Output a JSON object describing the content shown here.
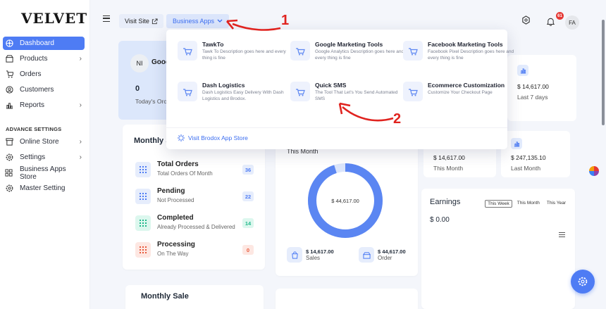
{
  "brand": {
    "logo": "VELVET"
  },
  "sidebar": {
    "items": [
      {
        "label": "Dashboard",
        "icon": "dashboard-icon",
        "active": true,
        "chevron": false
      },
      {
        "label": "Products",
        "icon": "products-icon",
        "chevron": true
      },
      {
        "label": "Orders",
        "icon": "cart-icon",
        "chevron": false
      },
      {
        "label": "Customers",
        "icon": "user-icon",
        "chevron": false
      },
      {
        "label": "Reports",
        "icon": "chart-icon",
        "chevron": true
      }
    ],
    "section_title": "ADVANCE SETTINGS",
    "advance_items": [
      {
        "label": "Online Store",
        "icon": "store-icon",
        "chevron": true
      },
      {
        "label": "Settings",
        "icon": "gear-icon",
        "chevron": true
      },
      {
        "label": "Business Apps Store",
        "icon": "apps-icon",
        "chevron": false
      },
      {
        "label": "Master Setting",
        "icon": "gear-icon",
        "chevron": false
      }
    ]
  },
  "header": {
    "visit_site": "Visit Site",
    "business_apps": "Business Apps",
    "notification_count": "61",
    "avatar_initials": "FA"
  },
  "welcome": {
    "avatar_initials": "NI",
    "name": "Good",
    "count": "0",
    "count_label": "Today's Orc"
  },
  "dropdown": {
    "apps": [
      {
        "name": "TawkTo",
        "desc": "Tawk To Description goes here and every thing is fine"
      },
      {
        "name": "Google Marketing Tools",
        "desc": "Google Analytics Description goes here and every thing is fine"
      },
      {
        "name": "Facebook Marketing Tools",
        "desc": "Facebook Pixel Description goes here and every thing is fine"
      },
      {
        "name": "Dash Logistics",
        "desc": "Dash Logistics Easy Delivery With Dash Logistics and Brodox."
      },
      {
        "name": "Quick SMS",
        "desc": "The Tool That Let's You Send Automated SMS"
      },
      {
        "name": "Ecommerce Customization",
        "desc": "Customize Your Checkout Page"
      }
    ],
    "store_link": "Visit Brodox App Store"
  },
  "monthly_status": {
    "title": "Monthly S",
    "rows": [
      {
        "name": "Total Orders",
        "sub": "Total Orders Of Month",
        "count": "36",
        "bg": "#e6edfc",
        "fg": "#4e7cf4"
      },
      {
        "name": "Pending",
        "sub": "Not Processed",
        "count": "22",
        "bg": "#e6edfc",
        "fg": "#4e7cf4"
      },
      {
        "name": "Completed",
        "sub": "Already Processed & Delivered",
        "count": "14",
        "bg": "#dcf7ee",
        "fg": "#1fb88a"
      },
      {
        "name": "Processing",
        "sub": "On The Way",
        "count": "0",
        "bg": "#fde7e2",
        "fg": "#e85a3c"
      }
    ]
  },
  "month_card": {
    "label": "This Month",
    "donut_value": "$ 44,617.00",
    "progress": 0.95,
    "sales_value": "$ 14,617.00",
    "sales_label": "Sales",
    "order_value": "$ 44,617.00",
    "order_label": "Order"
  },
  "stats": {
    "last7_value": "$ 14,617.00",
    "last7_label": "Last 7 days",
    "this_month_value": "$ 14,617.00",
    "this_month_label": "This Month",
    "last_month_value": "$ 247,135.10",
    "last_month_label": "Last Month"
  },
  "earnings": {
    "title": "Earnings",
    "tabs": [
      "This Week",
      "This Month",
      "This Year"
    ],
    "value": "$ 0.00"
  },
  "monthly_sale": {
    "title": "Monthly Sale"
  },
  "annotations": [
    "1",
    "2"
  ],
  "colors": {
    "accent": "#4e7cf4",
    "annotation": "#e0231f"
  }
}
